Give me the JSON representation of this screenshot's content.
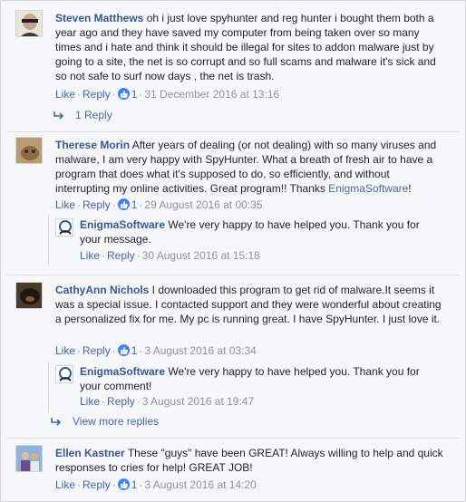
{
  "comments": [
    {
      "author": "Steven Matthews",
      "text": " oh i just love spyhunter and reg hunter i bought them both a year ago and they have saved my computer from being taken over so many times and i hate and think it should be illegal for sites to addon malware just by going to a site, the net is so corrupt and so full scams and malware it's sick and so not safe to surf now days , the net is trash.",
      "like": "Like",
      "reply": "Reply",
      "likes": "1",
      "date": "31 December 2016 at 13:16",
      "more_replies": "1 Reply"
    },
    {
      "author": "Therese Morin",
      "text_before": " After years of dealing (or not dealing) with so many viruses and malware, I am very happy with SpyHunter. What a breath of fresh air to have a program that does what it's supposed to do, so efficiently, and without interrupting my online activities. Great program!! Thanks ",
      "mention": "EnigmaSoftware",
      "text_after": "!",
      "like": "Like",
      "reply": "Reply",
      "likes": "1",
      "date": "29 August 2016 at 00:35",
      "reply_item": {
        "author": "EnigmaSoftware",
        "text": " We're very happy to have helped you. Thank you for your message.",
        "like": "Like",
        "reply": "Reply",
        "date": "30 August 2016 at 15:18"
      }
    },
    {
      "author": "CathyAnn Nichols",
      "text": " I downloaded this program to get rid of malware.It seems it was a special issue. I contacted support and they were wonderful about creating a personalized fix for me. My pc is running great. I have SpyHunter. I just love it.",
      "like": "Like",
      "reply": "Reply",
      "likes": "1",
      "date": "3 August 2016 at 03:34",
      "reply_item": {
        "author": "EnigmaSoftware",
        "text": " We're very happy to have helped you. Thank you for your comment!",
        "like": "Like",
        "reply": "Reply",
        "date": "3 August 2016 at 19:47"
      },
      "more_replies": "View more replies"
    },
    {
      "author": "Ellen Kastner",
      "text": " These \"guys\" have been GREAT! Always willing to help and quick responses to cries for help! GREAT JOB!",
      "like": "Like",
      "reply": "Reply",
      "likes": "1",
      "date": "3 August 2016 at 14:20"
    }
  ],
  "colors": {
    "link": "#4267b2",
    "author": "#365899",
    "muted": "#90949c",
    "like_badge": "#4080ff",
    "background": "#f6f7f9"
  },
  "icons": {
    "like_badge": "thumbs-up-icon",
    "reply_arrow": "reply-arrow-icon"
  }
}
